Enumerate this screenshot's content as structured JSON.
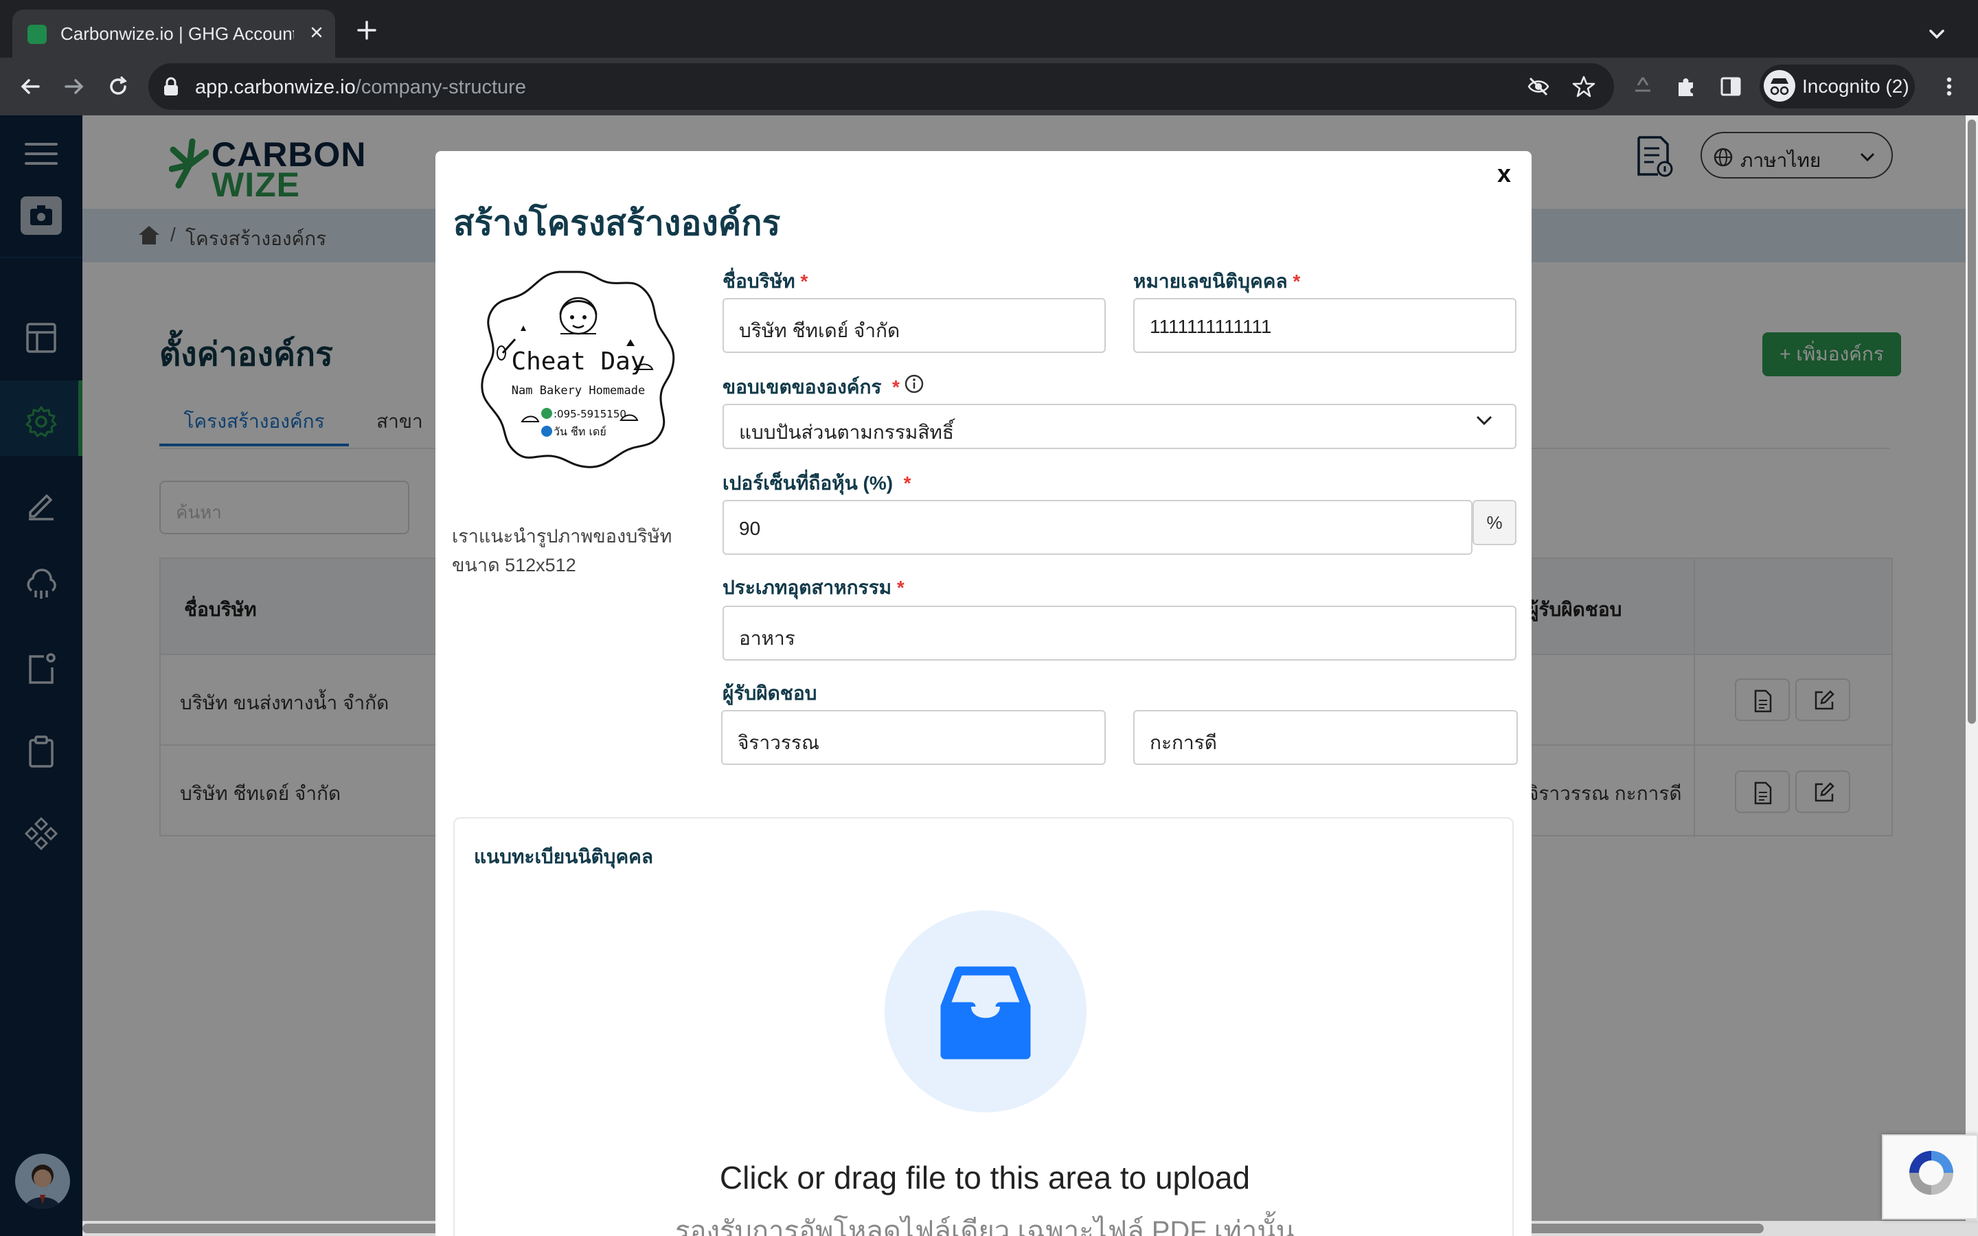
{
  "browser": {
    "tab_title": "Carbonwize.io | GHG Accounting",
    "url_host": "app.carbonwize.io",
    "url_path": "/company-structure",
    "profile_label": "Incognito (2)"
  },
  "app": {
    "logo_line1": "CARBON",
    "logo_line2": "WIZE",
    "language": "ภาษาไทย",
    "breadcrumb": "โครงสร้างองค์กร",
    "page_title": "ตั้งค่าองค์กร",
    "add_org_button": "+ เพิ่มองค์กร",
    "tabs": [
      "โครงสร้างองค์กร",
      "สาขา"
    ],
    "search_placeholder": "ค้นหา",
    "table": {
      "headers": {
        "company": "ชื่อบริษัท",
        "owner": "ผู้รับผิดชอบ"
      },
      "rows": [
        {
          "company": "บริษัท ขนส่งทางน้ำ จำกัด",
          "owner": ""
        },
        {
          "company": "บริษัท ชีทเดย์ จำกัด",
          "owner": "จิราวรรณ กะการดี"
        }
      ]
    }
  },
  "modal": {
    "close_label": "x",
    "title": "สร้างโครงสร้างองค์กร",
    "logo_hint": "เราแนะนำรูปภาพของบริษัท ขนาด 512x512",
    "logo_image": {
      "line1": "Cheat Day",
      "line2": "Nam Bakery Homemade",
      "phone": ":095-5915150",
      "facebook": "วัน ชีท เดย์"
    },
    "fields": {
      "company_name": {
        "label": "ชื่อบริษัท",
        "required": "*",
        "value": "บริษัท ชีทเดย์ จำกัด"
      },
      "juristic_id": {
        "label": "หมายเลขนิติบุคคล",
        "required": "*",
        "value": "1111111111111"
      },
      "scope": {
        "label": "ขอบเขตขององค์กร",
        "required": "*",
        "value": "แบบปันส่วนตามกรรมสิทธิ์"
      },
      "share_percent": {
        "label": "เปอร์เซ็นที่ถือหุ้น (%)",
        "required": "*",
        "value": "90",
        "suffix": "%"
      },
      "industry": {
        "label": "ประเภทอุตสาหกรรม",
        "required": "*",
        "value": "อาหาร"
      },
      "owner": {
        "label": "ผู้รับผิดชอบ",
        "first_name": "จิราวรรณ",
        "last_name": "กะการดี"
      }
    },
    "upload": {
      "label": "แนบทะเบียนนิติบุคคล",
      "title": "Click or drag file to this area to upload",
      "subtitle": "รองรับการอัพโหลดไฟล์เดียว เฉพาะไฟล์ PDF เท่านั้น"
    }
  },
  "colors": {
    "brand_green": "#2e9b52",
    "brand_navy": "#0b2540",
    "link_blue": "#1a73c8",
    "required_red": "#e53935",
    "upload_blue": "#1677ff"
  }
}
